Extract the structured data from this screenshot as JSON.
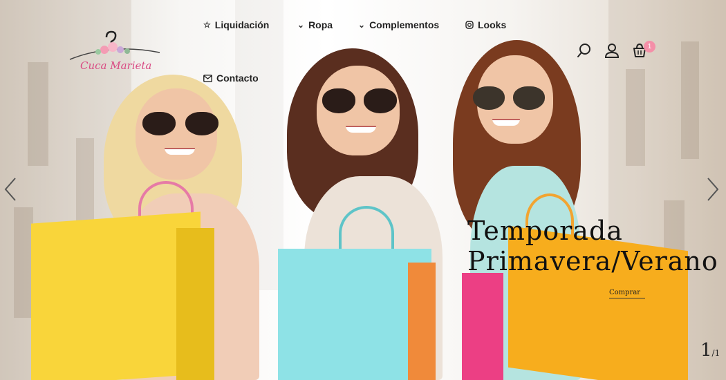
{
  "brand": {
    "logo_text": "Cuca Marieta"
  },
  "nav": {
    "items": [
      {
        "label": "Liquidación",
        "icon": "star-icon"
      },
      {
        "label": "Ropa",
        "icon": "chevron-down-icon"
      },
      {
        "label": "Complementos",
        "icon": "chevron-down-icon"
      },
      {
        "label": "Looks",
        "icon": "instagram-icon"
      },
      {
        "label": "Contacto",
        "icon": "envelope-icon"
      }
    ]
  },
  "header_actions": {
    "icons": [
      "search-icon",
      "user-icon",
      "cart-icon"
    ],
    "cart_count": "1"
  },
  "slide": {
    "title_line1": "Temporada",
    "title_line2": "Primavera/Verano",
    "button_label": "Comprar",
    "current": "1",
    "total": "/1"
  },
  "colors": {
    "accent": "#f48fa8",
    "logo_pink": "#d94a83",
    "text": "#222222"
  }
}
